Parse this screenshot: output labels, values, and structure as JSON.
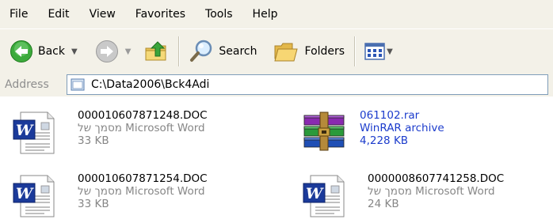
{
  "menu": [
    "File",
    "Edit",
    "View",
    "Favorites",
    "Tools",
    "Help"
  ],
  "toolbar": {
    "back_label": "Back",
    "search_label": "Search",
    "folders_label": "Folders"
  },
  "address": {
    "label": "Address",
    "path": "C:\\Data2006\\Bck4Adi"
  },
  "files": [
    {
      "name": "000010607871248.DOC",
      "type": "מסמך של Microsoft Word",
      "size": "33 KB",
      "icon": "word-document-icon"
    },
    {
      "name": "061102.rar",
      "type": "WinRAR archive",
      "size": "4,228 KB",
      "icon": "winrar-archive-icon"
    },
    {
      "name": "000010607871254.DOC",
      "type": "מסמך של Microsoft Word",
      "size": "33 KB",
      "icon": "word-document-icon"
    },
    {
      "name": "0000008607741258.DOC",
      "type": "מסמך של Microsoft Word",
      "size": "24 KB",
      "icon": "word-document-icon"
    }
  ]
}
